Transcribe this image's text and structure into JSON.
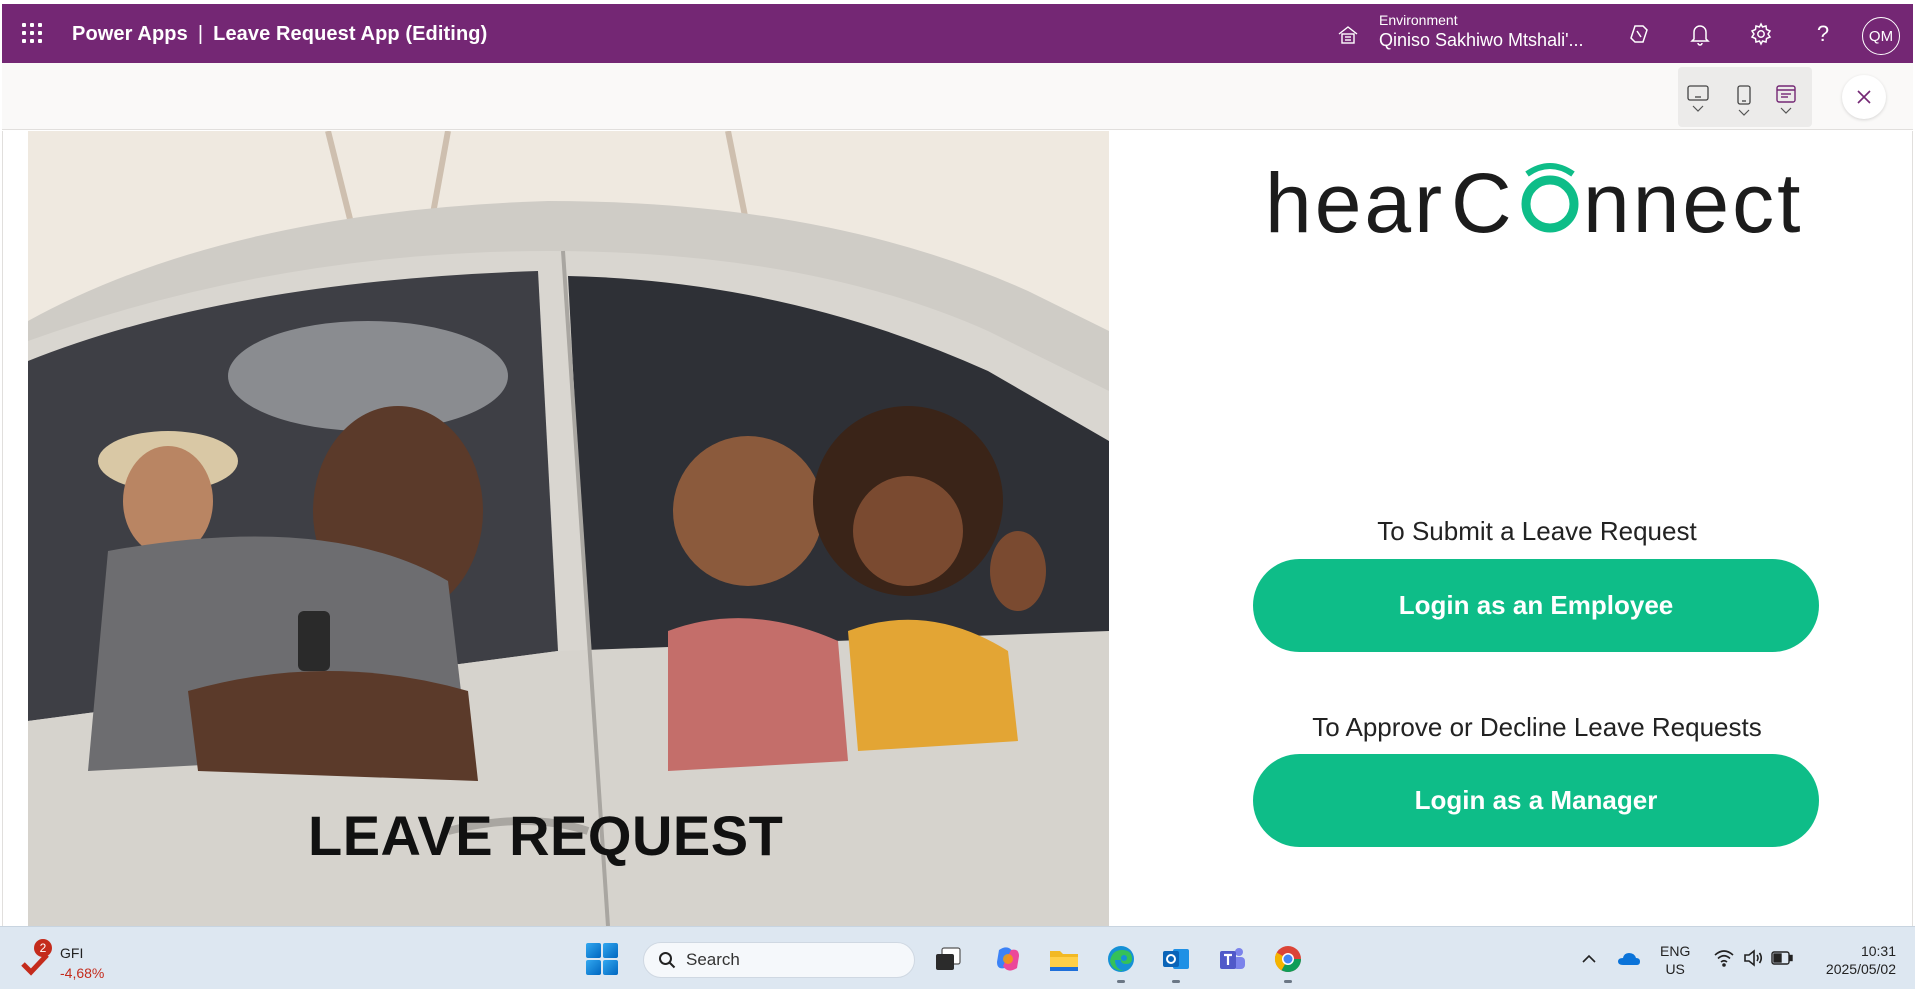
{
  "header": {
    "product": "Power Apps",
    "separator": "|",
    "app_title": "Leave Request App (Editing)",
    "environment_label": "Environment",
    "environment_value": "Qiniso Sakhiwo Mtshali'...",
    "avatar_initials": "QM",
    "background_color": "#742774",
    "icons": [
      "waffle-icon",
      "environment-icon",
      "copilot-icon",
      "bell-icon",
      "gear-icon",
      "help-icon"
    ]
  },
  "toolbar": {
    "icons": [
      "tablet-layout-icon",
      "phone-layout-icon",
      "web-layout-icon",
      "close-icon"
    ]
  },
  "canvas": {
    "hero_title": "LEAVE REQUEST",
    "logo": {
      "text_left": "hear",
      "text_o": "C",
      "text_right": "nnect",
      "accent_color": "#0ebd88"
    },
    "employee_prompt": "To Submit a Leave Request",
    "employee_button": "Login as an Employee",
    "manager_prompt": "To Approve or Decline Leave Requests",
    "manager_button": "Login as a Manager",
    "button_color": "#0ebd88"
  },
  "taskbar": {
    "widget_name": "GFI",
    "widget_change": "-4,68%",
    "widget_badge": "2",
    "search_placeholder": "Search",
    "apps": [
      "task-view-icon",
      "copilot-app-icon",
      "file-explorer-icon",
      "edge-icon",
      "outlook-icon",
      "teams-icon",
      "chrome-icon"
    ],
    "tray": {
      "language_line1": "ENG",
      "language_line2": "US",
      "time": "10:31",
      "date": "2025/05/02"
    }
  }
}
